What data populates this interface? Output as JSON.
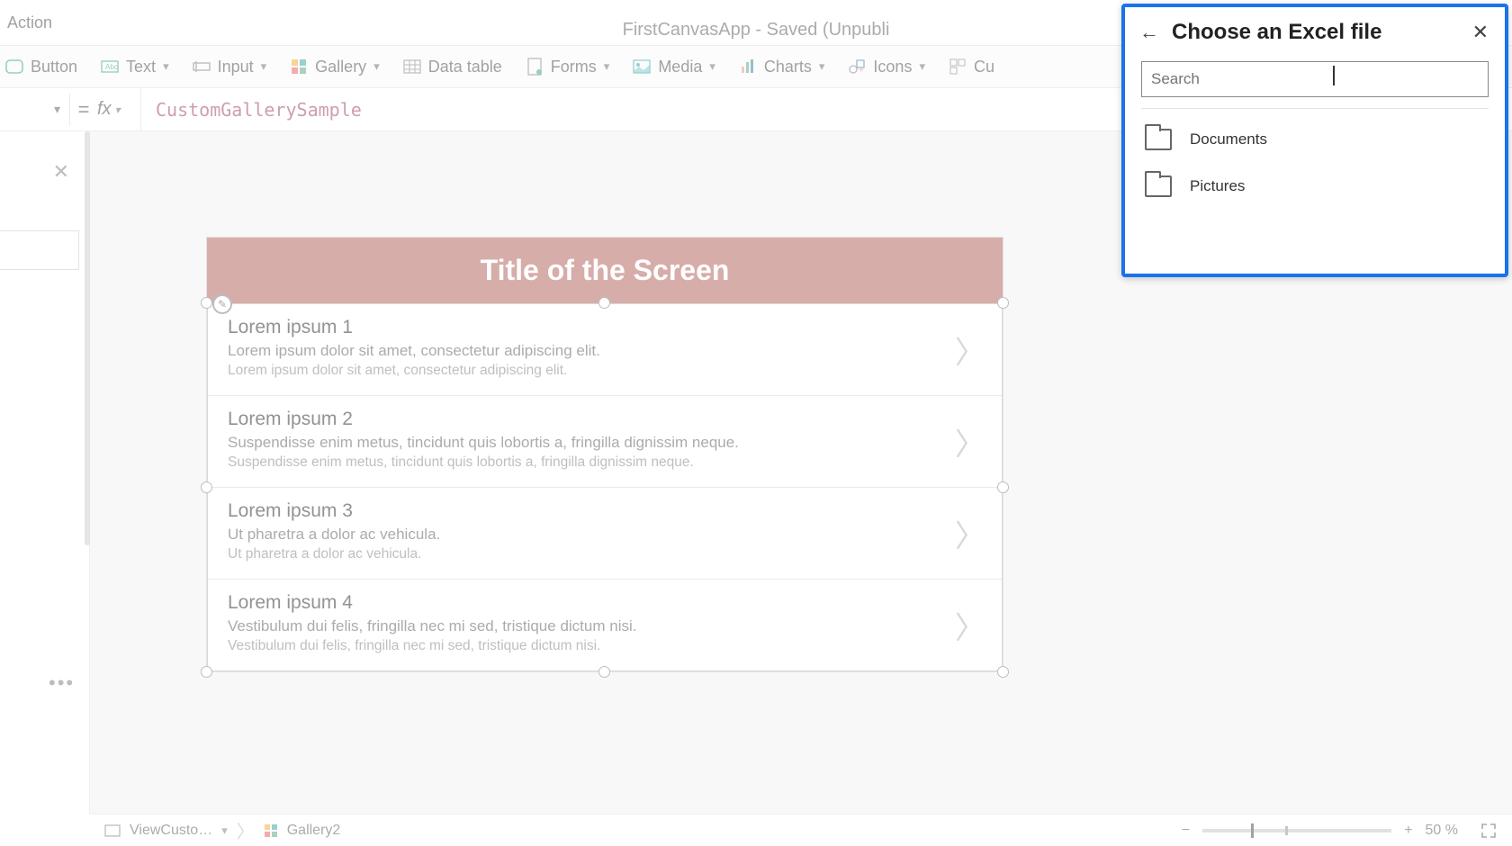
{
  "app_title": "FirstCanvasApp - Saved (Unpubli",
  "top_menu_partial": "Action",
  "ribbon": {
    "button": "Button",
    "text": "Text",
    "input": "Input",
    "gallery": "Gallery",
    "datatable": "Data table",
    "forms": "Forms",
    "media": "Media",
    "charts": "Charts",
    "icons": "Icons",
    "custom": "Cu"
  },
  "formula": {
    "value": "CustomGallerySample",
    "fx": "fx",
    "equals": "="
  },
  "screen": {
    "title": "Title of the Screen",
    "items": [
      {
        "title": "Lorem ipsum 1",
        "sub": "Lorem ipsum dolor sit amet, consectetur adipiscing elit.",
        "body": "Lorem ipsum dolor sit amet, consectetur adipiscing elit."
      },
      {
        "title": "Lorem ipsum 2",
        "sub": "Suspendisse enim metus, tincidunt quis lobortis a, fringilla dignissim neque.",
        "body": "Suspendisse enim metus, tincidunt quis lobortis a, fringilla dignissim neque."
      },
      {
        "title": "Lorem ipsum 3",
        "sub": "Ut pharetra a dolor ac vehicula.",
        "body": "Ut pharetra a dolor ac vehicula."
      },
      {
        "title": "Lorem ipsum 4",
        "sub": "Vestibulum dui felis, fringilla nec mi sed, tristique dictum nisi.",
        "body": "Vestibulum dui felis, fringilla nec mi sed, tristique dictum nisi."
      }
    ]
  },
  "breadcrumb": {
    "screen": "ViewCusto…",
    "control": "Gallery2"
  },
  "zoom": {
    "pct": "50  %",
    "minus": "−",
    "plus": "+"
  },
  "flyout": {
    "title": "Choose an Excel file",
    "search_placeholder": "Search",
    "items": [
      {
        "label": "Documents"
      },
      {
        "label": "Pictures"
      }
    ]
  }
}
